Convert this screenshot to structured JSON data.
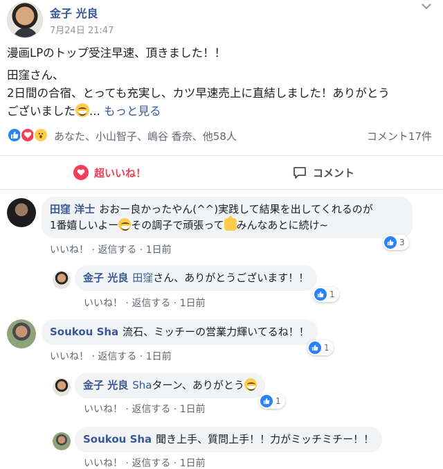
{
  "post": {
    "author": "金子 光良",
    "time": "7月24日 21:47",
    "line1": "漫画LPのトップ受注早速、頂きました！！",
    "line2": "田窪さん、",
    "line3": "2日間の合宿、とっても充実し、カツ早速売上に直結しました！ありがとう",
    "line4": "ございました",
    "ellipsis": "...",
    "see_more": "もっと見る"
  },
  "reactions": {
    "names": "あなた、小山智子、嶋谷 香奈、他58人",
    "comments_count": "コメント17件"
  },
  "actions": {
    "love_label": "超いいね！",
    "comment_label": "コメント"
  },
  "comments": [
    {
      "name": "田窪 洋士",
      "text_a": "おおー良かったやん(^^)実践して結果を出してくれるのが",
      "text_b": "1番嬉しいよー",
      "text_c": "その調子で頑張って",
      "text_d": "みんなあとに続け~",
      "like": "いいね！",
      "reply": "返信する",
      "time": "1日前",
      "reactions": "3"
    },
    {
      "name": "金子 光良",
      "mention": "田窪",
      "text": "さん、ありがとうございます！！",
      "like": "いいね！",
      "reply": "返信する",
      "time": "1日前",
      "reactions": "1"
    },
    {
      "name": "Soukou Sha",
      "text": "流石、ミッチーの営業力輝いてるね！！",
      "like": "いいね！",
      "reply": "返信する",
      "time": "1日前",
      "reactions": "1"
    },
    {
      "name": "金子 光良",
      "mention": "Sha",
      "text": "ターン、ありがとう",
      "like": "いいね！",
      "reply": "返信する",
      "time": "1日前",
      "reactions": "1"
    },
    {
      "name": "Soukou Sha",
      "text": "聞き上手、質問上手！！力がミッチミチー！！",
      "like": "いいね！",
      "reply": "返信する",
      "time": "1日前"
    }
  ],
  "colors": {
    "link": "#385898",
    "like_blue": "#2b82f6",
    "love_red": "#f33e58",
    "bubble_bg": "#f2f3f5"
  },
  "icons": [
    "like-icon",
    "love-icon",
    "wow-icon",
    "comment-icon",
    "chevron-down-icon"
  ]
}
